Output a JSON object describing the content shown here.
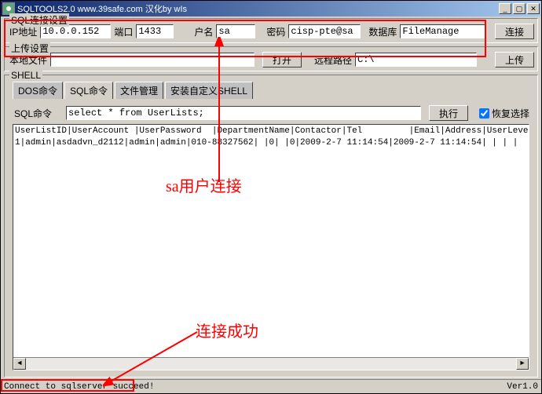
{
  "window": {
    "title": "SQLTOOLS2.0 www.39safe.com 汉化by wIs"
  },
  "conn": {
    "legend": "SQL连接设置",
    "ip_label": "IP地址",
    "ip_value": "10.0.0.152",
    "port_label": "端口",
    "port_value": "1433",
    "user_label": "户名",
    "user_value": "sa",
    "pass_label": "密码",
    "pass_value": "cisp-pte@sa",
    "db_label": "数据库",
    "db_value": "FileManage",
    "connect_btn": "连接"
  },
  "upload": {
    "legend": "上传设置",
    "local_label": "本地文件",
    "local_value": "",
    "open_btn": "打开",
    "remote_label": "远程路径",
    "remote_value": "C:\\",
    "upload_btn": "上传"
  },
  "shell": {
    "legend": "SHELL",
    "tabs": [
      "DOS命令",
      "SQL命令",
      "文件管理",
      "安装自定义SHELL"
    ],
    "active_tab": 1,
    "cmd_label": "SQL命令",
    "cmd_value": "select * from UserLists;",
    "exec_btn": "执行",
    "restore_chk": "恢复选择"
  },
  "output_header": "UserListID|UserAccount |UserPassword  |DepartmentName|Contactor|Tel         |Email|Address|UserLevel|IsAllowed|UserDescripti",
  "output_row": "1|admin|asdadvn_d2112|admin|admin|010-88327562| |0| |0|2009-2-7 11:14:54|2009-2-7 11:14:54| | | |",
  "status": {
    "left": "Connect to sqlserver succeed!",
    "right": "Ver1.0"
  },
  "annotations": {
    "a1": "sa用户连接",
    "a2": "连接成功"
  }
}
